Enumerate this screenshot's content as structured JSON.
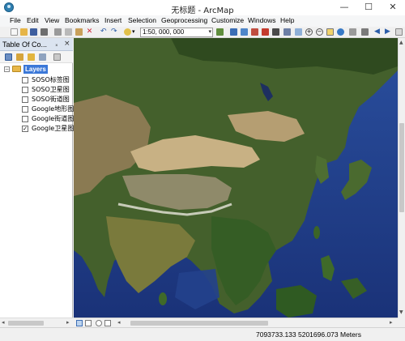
{
  "window": {
    "title": "无标题 - ArcMap",
    "minimize_glyph": "—",
    "maximize_glyph": "☐",
    "close_glyph": "✕"
  },
  "menu": [
    "File",
    "Edit",
    "View",
    "Bookmarks",
    "Insert",
    "Selection",
    "Geoprocessing",
    "Customize",
    "Windows",
    "Help"
  ],
  "toolbar": {
    "scale_value": "1:50, 000, 000",
    "scale_arrow": "▾",
    "icons": [
      "new-icon",
      "open-icon",
      "save-icon",
      "print-icon",
      "cut-icon",
      "copy-icon",
      "paste-icon",
      "delete-icon",
      "undo-icon",
      "redo-icon",
      "add-data-icon",
      "scale-icon",
      "editor-icon",
      "table-icon",
      "catalog-icon",
      "search-icon",
      "arctoolbox-icon",
      "python-icon",
      "zoom-in-icon",
      "zoom-out-icon",
      "pan-icon",
      "full-extent-icon",
      "back-icon",
      "forward-icon",
      "select-icon",
      "identify-icon"
    ]
  },
  "toc": {
    "title": "Table Of Co...",
    "pin_glyph": "ₓ",
    "close_glyph": "×",
    "root": {
      "label": "Layers",
      "expander": "−"
    },
    "layers": [
      {
        "label": "SOSO标签图",
        "checked": false
      },
      {
        "label": "SOSO卫星图",
        "checked": false
      },
      {
        "label": "SOSO街道图",
        "checked": false
      },
      {
        "label": "Google地形图",
        "checked": false
      },
      {
        "label": "Google街道图",
        "checked": false
      },
      {
        "label": "Google卫星图",
        "checked": true
      }
    ],
    "check_glyph": "✓"
  },
  "scroll": {
    "left_arrow": "◂",
    "right_arrow": "▸",
    "up_arrow": "▲",
    "down_arrow": "▼"
  },
  "status": {
    "coordinates": "7093733.133  5201696.073 Meters"
  },
  "colors": {
    "ocean": "#1f3b8a",
    "land_green": "#44602c",
    "desert": "#bda77d",
    "selection": "#3b78d8"
  }
}
